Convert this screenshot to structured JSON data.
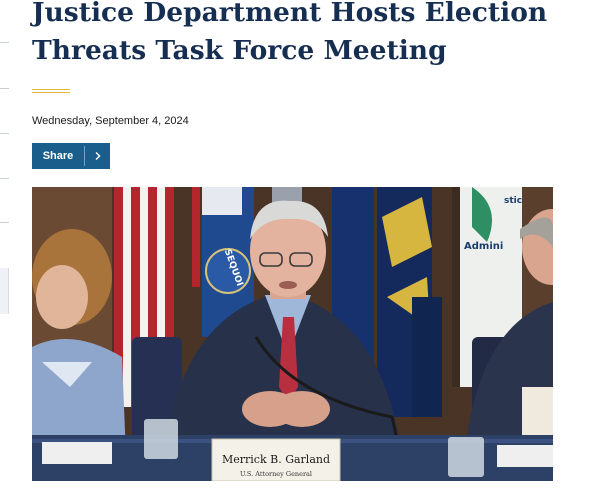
{
  "article": {
    "title": "Justice Department Hosts Election Threats Task Force Meeting",
    "date": "Wednesday, September 4, 2024"
  },
  "share": {
    "label": "Share",
    "icon": "chevron-right-icon"
  },
  "photo": {
    "nameplate_name": "Merrick B. Garland",
    "nameplate_title": "U.S. Attorney General",
    "flag_text_1": "SEQUOI",
    "flag_text_2": "Admini",
    "flag_text_3": "stic"
  },
  "colors": {
    "title": "#162e51",
    "accent": "#e4b73a",
    "button": "#1a5e8c"
  }
}
